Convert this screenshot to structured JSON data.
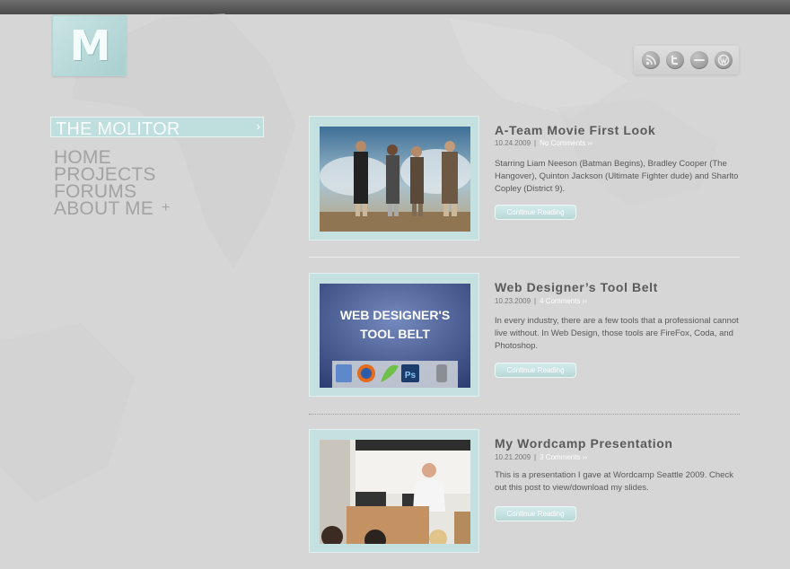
{
  "logo": {
    "letter": "M"
  },
  "social": {
    "icons": [
      "rss-icon",
      "twitter-icon",
      "facebook-icon",
      "wordpress-icon"
    ]
  },
  "sidebar": {
    "active_label": "THE MOLITOR",
    "active_arrow": "›",
    "items": [
      {
        "label": "HOME"
      },
      {
        "label": "PROJECTS"
      },
      {
        "label": "FORUMS"
      },
      {
        "label": "ABOUT ME"
      }
    ],
    "expand_symbol": "+"
  },
  "posts": [
    {
      "title": "A-Team Movie First Look",
      "date": "10.24.2009",
      "separator": "|",
      "comments": "No Comments ››",
      "excerpt": "Starring Liam Neeson (Batman Begins), Bradley Cooper (The Hangover), Quinton Jackson (Ultimate Fighter dude) and Sharlto Copley (District 9).",
      "button": "Continue Reading"
    },
    {
      "title": "Web Designer’s Tool Belt",
      "date": "10.23.2009",
      "separator": "|",
      "comments": "4 Comments ››",
      "excerpt": "In every industry, there are a few tools that a professional cannot live without. In Web Design, those tools are FireFox, Coda, and Photoshop.",
      "button": "Continue Reading",
      "image_text": [
        "WEB DESIGNER'S",
        "TOOL BELT"
      ],
      "dock_labels": {
        "ps": "Ps"
      }
    },
    {
      "title": "My Wordcamp Presentation",
      "date": "10.21.2009",
      "separator": "|",
      "comments": "3 Comments ››",
      "excerpt": "This is a presentation I gave at Wordcamp Seattle 2009. Check out this post to view/download my slides.",
      "button": "Continue Reading"
    }
  ],
  "colors": {
    "background": "#d6d6d6",
    "accent": "#bfdede",
    "nav_text": "#a3a3a3",
    "title_text": "#5a5a5a"
  }
}
